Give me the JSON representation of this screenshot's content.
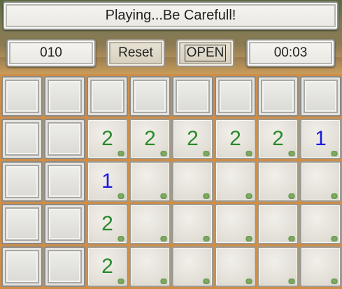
{
  "header": {
    "status_text": "Playing...Be Carefull!",
    "mine_counter": "010",
    "reset_label": "Reset",
    "open_label": "OPEN",
    "timer": "00:03"
  },
  "colors": {
    "number_1": "#1a1ae0",
    "number_2": "#2a8a2a",
    "background": "#c98a45"
  },
  "board": {
    "rows": [
      [
        "",
        "",
        "",
        "",
        "",
        "",
        "",
        ""
      ],
      [
        "",
        "",
        "2",
        "2",
        "2",
        "2",
        "2",
        "1"
      ],
      [
        "",
        "",
        "1",
        " ",
        " ",
        " ",
        " ",
        " "
      ],
      [
        "",
        "",
        "2",
        " ",
        " ",
        " ",
        " ",
        " "
      ],
      [
        "",
        "",
        "2",
        " ",
        " ",
        " ",
        " ",
        " "
      ]
    ],
    "states": [
      [
        "covered",
        "covered",
        "covered",
        "covered",
        "covered",
        "covered",
        "covered",
        "covered"
      ],
      [
        "covered",
        "covered",
        "open",
        "open",
        "open",
        "open",
        "open",
        "open"
      ],
      [
        "covered",
        "covered",
        "open",
        "open",
        "open",
        "open",
        "open",
        "open"
      ],
      [
        "covered",
        "covered",
        "open",
        "open",
        "open",
        "open",
        "open",
        "open"
      ],
      [
        "covered",
        "covered",
        "open",
        "open",
        "open",
        "open",
        "open",
        "open"
      ]
    ]
  }
}
